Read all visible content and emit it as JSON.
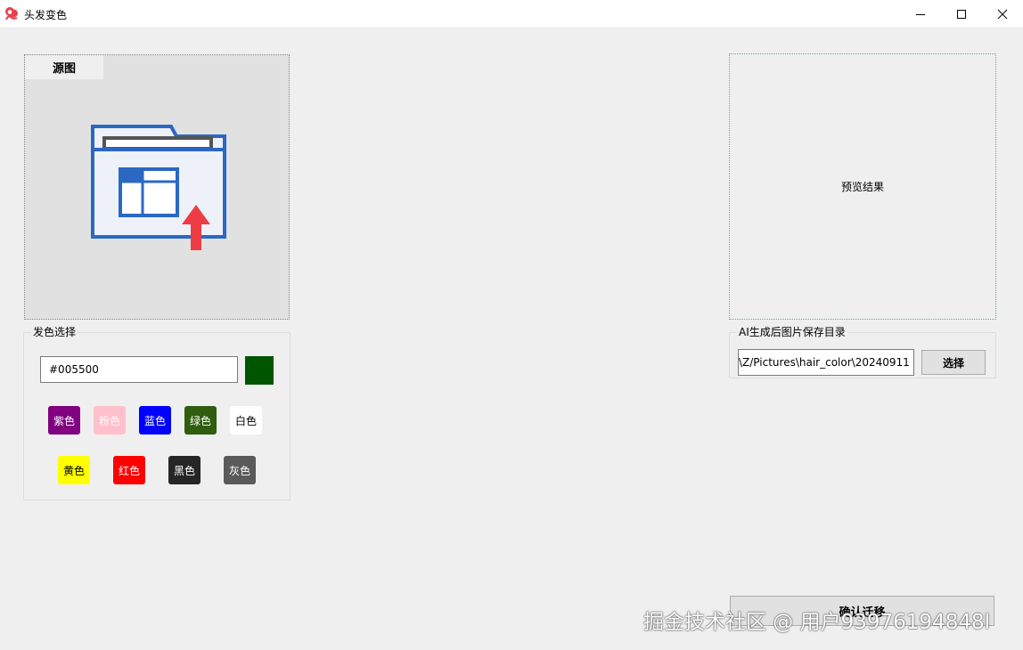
{
  "window": {
    "title": "头发变色",
    "icon": "hair-icon",
    "controls": [
      "minimize-icon",
      "maximize-icon",
      "close-icon"
    ]
  },
  "source": {
    "tab_label": "源图",
    "placeholder_icon": "folder-upload-icon"
  },
  "hair_color": {
    "group_label": "发色选择",
    "hex_value": "#005500",
    "preview_color": "#005500",
    "presets": [
      {
        "label": "紫色",
        "bg": "#800080",
        "fg": "#ffffff"
      },
      {
        "label": "粉色",
        "bg": "#ffc0cb",
        "fg": "#ffffff"
      },
      {
        "label": "蓝色",
        "bg": "#0000ff",
        "fg": "#ffffff"
      },
      {
        "label": "绿色",
        "bg": "#2e5e0e",
        "fg": "#ffffff"
      },
      {
        "label": "白色",
        "bg": "#ffffff",
        "fg": "#000000"
      },
      {
        "label": "黄色",
        "bg": "#ffff00",
        "fg": "#000000"
      },
      {
        "label": "红色",
        "bg": "#ff0000",
        "fg": "#ffffff"
      },
      {
        "label": "黑色",
        "bg": "#262626",
        "fg": "#ffffff"
      },
      {
        "label": "灰色",
        "bg": "#5a5a5a",
        "fg": "#ffffff"
      }
    ]
  },
  "preview": {
    "label": "预览结果"
  },
  "save_dir": {
    "group_label": "AI生成后图片保存目录",
    "path_value": "\\Z/Pictures\\hair_color\\20240911",
    "choose_label": "选择"
  },
  "confirm": {
    "label": "确认迁移"
  },
  "watermark": {
    "text": "掘金技术社区 @ 用户93976194848l"
  }
}
